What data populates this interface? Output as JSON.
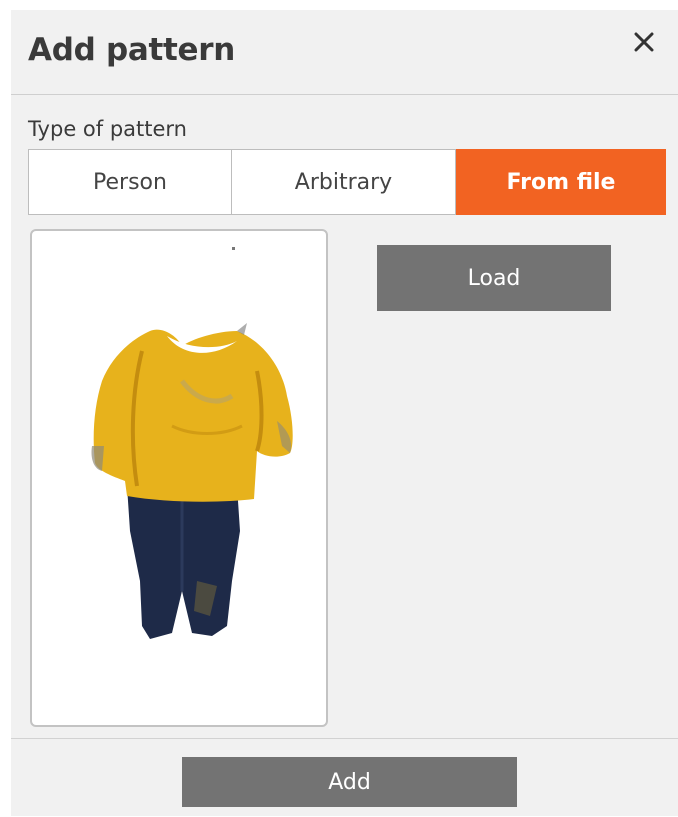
{
  "dialog": {
    "title": "Add pattern",
    "close_icon": "close-icon"
  },
  "type_selector": {
    "label": "Type of pattern",
    "options": [
      "Person",
      "Arbitrary",
      "From file"
    ],
    "selected": "From file"
  },
  "preview": {
    "image_icon": "person-figure-image"
  },
  "actions": {
    "load_label": "Load",
    "add_label": "Add"
  },
  "colors": {
    "accent": "#f26322",
    "button_gray": "#737373",
    "panel_bg": "#f1f1f1"
  }
}
